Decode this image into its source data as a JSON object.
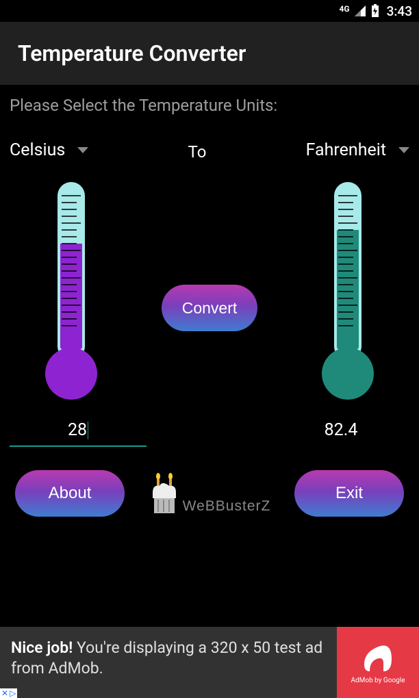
{
  "status": {
    "network": "4G",
    "clock": "3:43"
  },
  "app": {
    "title": "Temperature Converter",
    "prompt": "Please Select the Temperature Units:",
    "from_unit": "Celsius",
    "to_label": "To",
    "to_unit": "Fahrenheit",
    "convert_label": "Convert",
    "input_value": "28",
    "output_value": "82.4",
    "about_label": "About",
    "exit_label": "Exit",
    "logo_text": "WeBBusterZ"
  },
  "thermometer": {
    "left_fill_fraction": 0.65,
    "right_fill_fraction": 0.75,
    "left_fill_color": "#8e24d1",
    "right_fill_color": "#1f8a7a",
    "tube_color": "#a8e9e9"
  },
  "ad": {
    "bold": "Nice job!",
    "rest": " You're displaying a 320 x 50 test ad from AdMob.",
    "brand": "AdMob by Google"
  }
}
